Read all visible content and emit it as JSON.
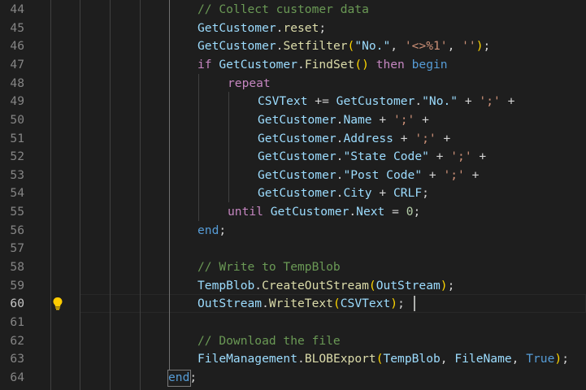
{
  "editor": {
    "lightbulb_icon": "lightbulb-icon",
    "active_line": "60",
    "lines": [
      {
        "num": "44",
        "tokens": [
          {
            "t": "// Collect customer data",
            "c": "c-com"
          }
        ]
      },
      {
        "num": "45",
        "tokens": [
          {
            "t": "GetCustomer",
            "c": "c-var"
          },
          {
            "t": ".",
            "c": "c-p"
          },
          {
            "t": "reset",
            "c": "c-fn"
          },
          {
            "t": ";",
            "c": "c-p"
          }
        ]
      },
      {
        "num": "46",
        "tokens": [
          {
            "t": "GetCustomer",
            "c": "c-var"
          },
          {
            "t": ".",
            "c": "c-p"
          },
          {
            "t": "Setfilter",
            "c": "c-fn"
          },
          {
            "t": "(",
            "c": "c-br1"
          },
          {
            "t": "\"No.\"",
            "c": "c-var"
          },
          {
            "t": ", ",
            "c": "c-p"
          },
          {
            "t": "'<>%1'",
            "c": "c-str"
          },
          {
            "t": ", ",
            "c": "c-p"
          },
          {
            "t": "''",
            "c": "c-str"
          },
          {
            "t": ")",
            "c": "c-br1"
          },
          {
            "t": ";",
            "c": "c-p"
          }
        ]
      },
      {
        "num": "47",
        "tokens": [
          {
            "t": "if ",
            "c": "c-kw"
          },
          {
            "t": "GetCustomer",
            "c": "c-var"
          },
          {
            "t": ".",
            "c": "c-p"
          },
          {
            "t": "FindSet",
            "c": "c-fn"
          },
          {
            "t": "()",
            "c": "c-br1"
          },
          {
            "t": " then ",
            "c": "c-kw"
          },
          {
            "t": "begin",
            "c": "c-key"
          }
        ]
      },
      {
        "num": "48",
        "tokens": [
          {
            "t": "repeat",
            "c": "c-kw"
          }
        ]
      },
      {
        "num": "49",
        "tokens": [
          {
            "t": "CSVText",
            "c": "c-var"
          },
          {
            "t": " += ",
            "c": "c-p"
          },
          {
            "t": "GetCustomer",
            "c": "c-var"
          },
          {
            "t": ".",
            "c": "c-p"
          },
          {
            "t": "\"No.\"",
            "c": "c-var"
          },
          {
            "t": " + ",
            "c": "c-p"
          },
          {
            "t": "';'",
            "c": "c-str"
          },
          {
            "t": " +",
            "c": "c-p"
          }
        ]
      },
      {
        "num": "50",
        "tokens": [
          {
            "t": "GetCustomer",
            "c": "c-var"
          },
          {
            "t": ".",
            "c": "c-p"
          },
          {
            "t": "Name",
            "c": "c-var"
          },
          {
            "t": " + ",
            "c": "c-p"
          },
          {
            "t": "';'",
            "c": "c-str"
          },
          {
            "t": " +",
            "c": "c-p"
          }
        ]
      },
      {
        "num": "51",
        "tokens": [
          {
            "t": "GetCustomer",
            "c": "c-var"
          },
          {
            "t": ".",
            "c": "c-p"
          },
          {
            "t": "Address",
            "c": "c-var"
          },
          {
            "t": " + ",
            "c": "c-p"
          },
          {
            "t": "';'",
            "c": "c-str"
          },
          {
            "t": " +",
            "c": "c-p"
          }
        ]
      },
      {
        "num": "52",
        "tokens": [
          {
            "t": "GetCustomer",
            "c": "c-var"
          },
          {
            "t": ".",
            "c": "c-p"
          },
          {
            "t": "\"State Code\"",
            "c": "c-var"
          },
          {
            "t": " + ",
            "c": "c-p"
          },
          {
            "t": "';'",
            "c": "c-str"
          },
          {
            "t": " +",
            "c": "c-p"
          }
        ]
      },
      {
        "num": "53",
        "tokens": [
          {
            "t": "GetCustomer",
            "c": "c-var"
          },
          {
            "t": ".",
            "c": "c-p"
          },
          {
            "t": "\"Post Code\"",
            "c": "c-var"
          },
          {
            "t": " + ",
            "c": "c-p"
          },
          {
            "t": "';'",
            "c": "c-str"
          },
          {
            "t": " +",
            "c": "c-p"
          }
        ]
      },
      {
        "num": "54",
        "tokens": [
          {
            "t": "GetCustomer",
            "c": "c-var"
          },
          {
            "t": ".",
            "c": "c-p"
          },
          {
            "t": "City",
            "c": "c-var"
          },
          {
            "t": " + ",
            "c": "c-p"
          },
          {
            "t": "CRLF",
            "c": "c-var"
          },
          {
            "t": ";",
            "c": "c-p"
          }
        ]
      },
      {
        "num": "55",
        "tokens": [
          {
            "t": "until ",
            "c": "c-kw"
          },
          {
            "t": "GetCustomer",
            "c": "c-var"
          },
          {
            "t": ".",
            "c": "c-p"
          },
          {
            "t": "Next",
            "c": "c-var"
          },
          {
            "t": " = ",
            "c": "c-p"
          },
          {
            "t": "0",
            "c": "c-num"
          },
          {
            "t": ";",
            "c": "c-p"
          }
        ]
      },
      {
        "num": "56",
        "tokens": [
          {
            "t": "end",
            "c": "c-key"
          },
          {
            "t": ";",
            "c": "c-p"
          }
        ]
      },
      {
        "num": "57",
        "tokens": []
      },
      {
        "num": "58",
        "tokens": [
          {
            "t": "// Write to TempBlob",
            "c": "c-com"
          }
        ]
      },
      {
        "num": "59",
        "tokens": [
          {
            "t": "TempBlob",
            "c": "c-var"
          },
          {
            "t": ".",
            "c": "c-p"
          },
          {
            "t": "CreateOutStream",
            "c": "c-fn"
          },
          {
            "t": "(",
            "c": "c-br1"
          },
          {
            "t": "OutStream",
            "c": "c-var"
          },
          {
            "t": ")",
            "c": "c-br1"
          },
          {
            "t": ";",
            "c": "c-p"
          }
        ]
      },
      {
        "num": "60",
        "tokens": [
          {
            "t": "OutStream",
            "c": "c-var"
          },
          {
            "t": ".",
            "c": "c-p"
          },
          {
            "t": "WriteText",
            "c": "c-fn"
          },
          {
            "t": "(",
            "c": "c-br1"
          },
          {
            "t": "CSVText",
            "c": "c-var"
          },
          {
            "t": ")",
            "c": "c-br1"
          },
          {
            "t": ";",
            "c": "c-p"
          }
        ]
      },
      {
        "num": "61",
        "tokens": []
      },
      {
        "num": "62",
        "tokens": [
          {
            "t": "// Download the file",
            "c": "c-com"
          }
        ]
      },
      {
        "num": "63",
        "tokens": [
          {
            "t": "FileManagement",
            "c": "c-var"
          },
          {
            "t": ".",
            "c": "c-p"
          },
          {
            "t": "BLOBExport",
            "c": "c-fn"
          },
          {
            "t": "(",
            "c": "c-br1"
          },
          {
            "t": "TempBlob",
            "c": "c-var"
          },
          {
            "t": ", ",
            "c": "c-p"
          },
          {
            "t": "FileName",
            "c": "c-var"
          },
          {
            "t": ", ",
            "c": "c-p"
          },
          {
            "t": "True",
            "c": "c-key"
          },
          {
            "t": ")",
            "c": "c-br1"
          },
          {
            "t": ";",
            "c": "c-p"
          }
        ]
      },
      {
        "num": "64",
        "tokens": [
          {
            "t": "end",
            "c": "c-key"
          },
          {
            "t": ";",
            "c": "c-p"
          }
        ]
      }
    ]
  }
}
